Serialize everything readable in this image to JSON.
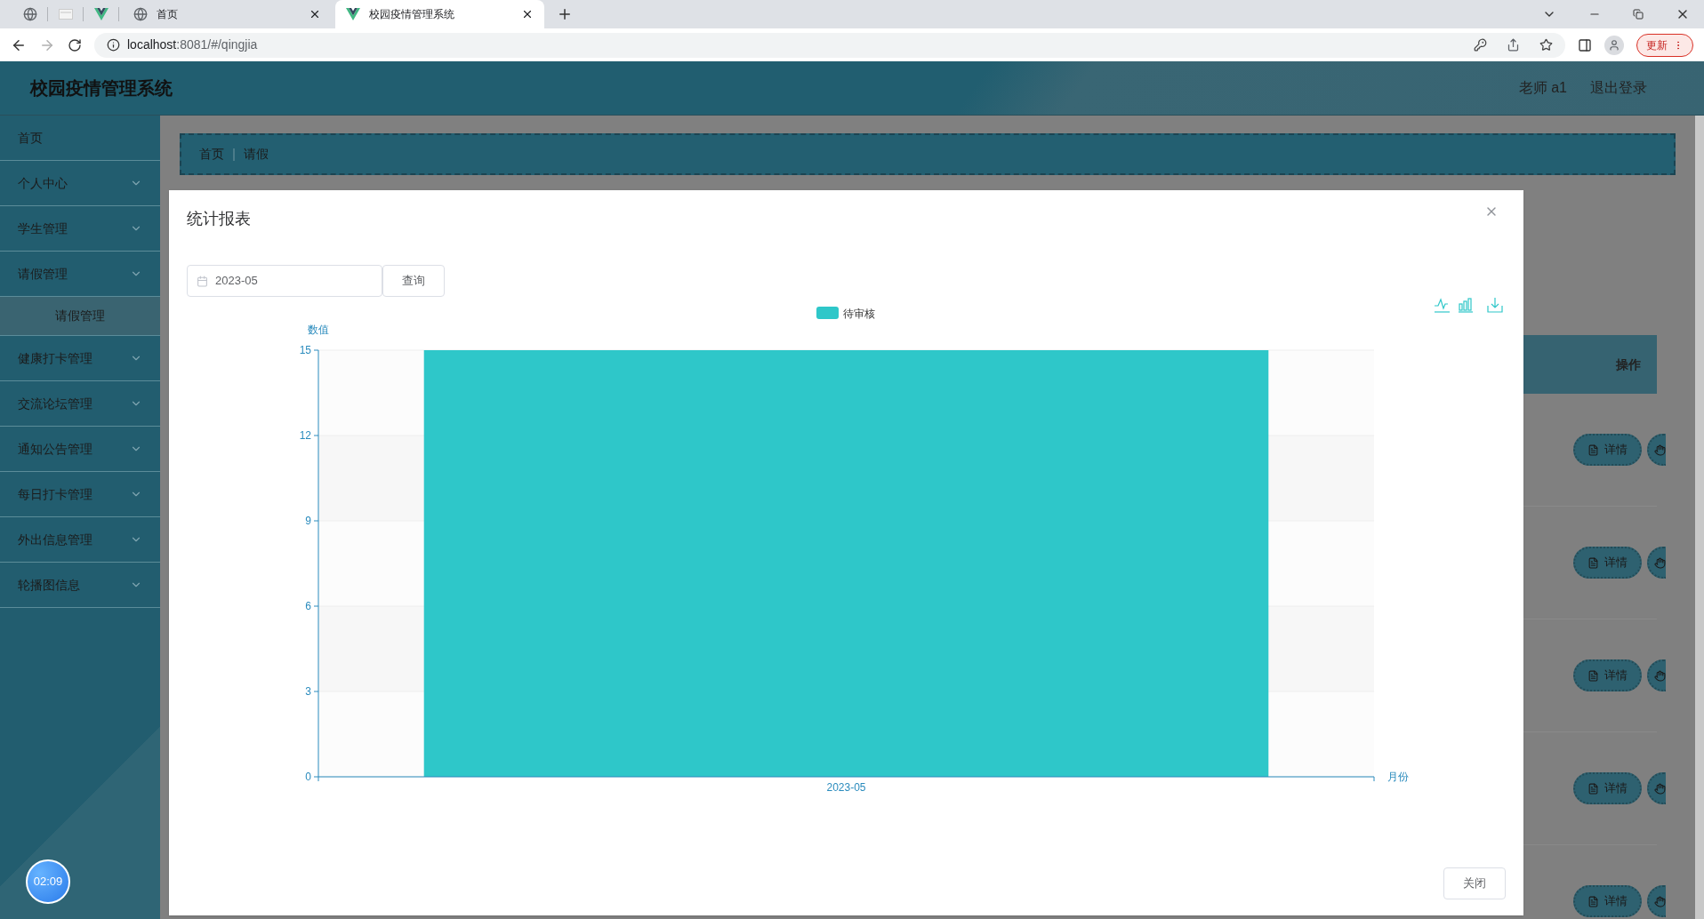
{
  "browser": {
    "pinned_tabs": [
      {
        "kind": "globe"
      },
      {
        "kind": "page"
      },
      {
        "kind": "vue"
      }
    ],
    "tabs": [
      {
        "title": "首页",
        "selected": false
      },
      {
        "title": "校园疫情管理系统",
        "selected": true
      }
    ],
    "url_host": "localhost",
    "url_rest": ":8081/#/qingjia",
    "update_button": "更新"
  },
  "header": {
    "title": "校园疫情管理系统",
    "user": "老师 a1",
    "logout": "退出登录"
  },
  "sidebar": {
    "items": [
      {
        "label": "首页",
        "kind": "link"
      },
      {
        "label": "个人中心",
        "kind": "menu"
      },
      {
        "label": "学生管理",
        "kind": "menu"
      },
      {
        "label": "请假管理",
        "kind": "menu",
        "children": [
          {
            "label": "请假管理"
          }
        ]
      },
      {
        "label": "健康打卡管理",
        "kind": "menu"
      },
      {
        "label": "交流论坛管理",
        "kind": "menu"
      },
      {
        "label": "通知公告管理",
        "kind": "menu"
      },
      {
        "label": "每日打卡管理",
        "kind": "menu"
      },
      {
        "label": "外出信息管理",
        "kind": "menu"
      },
      {
        "label": "轮播图信息",
        "kind": "menu"
      }
    ],
    "timer": "02:09"
  },
  "breadcrumb": [
    "首页",
    "请假"
  ],
  "table": {
    "column_header": "操作",
    "rows": [
      {
        "action": "详情"
      },
      {
        "action": "详情"
      },
      {
        "action": "详情"
      },
      {
        "action": "详情"
      },
      {
        "action": "详情"
      }
    ]
  },
  "dialog": {
    "title": "统计报表",
    "date_value": "2023-05",
    "query_button": "查询",
    "close_button": "关闭",
    "chart_data": {
      "type": "bar",
      "xlabel": "月份",
      "ylabel": "数值",
      "categories": [
        "2023-05"
      ],
      "series": [
        {
          "name": "待审核",
          "color": "#2ec7c9",
          "values": [
            15
          ]
        }
      ],
      "ylim": [
        0,
        15
      ],
      "yticks": [
        0,
        3,
        6,
        9,
        12,
        15
      ],
      "grid": true
    }
  }
}
